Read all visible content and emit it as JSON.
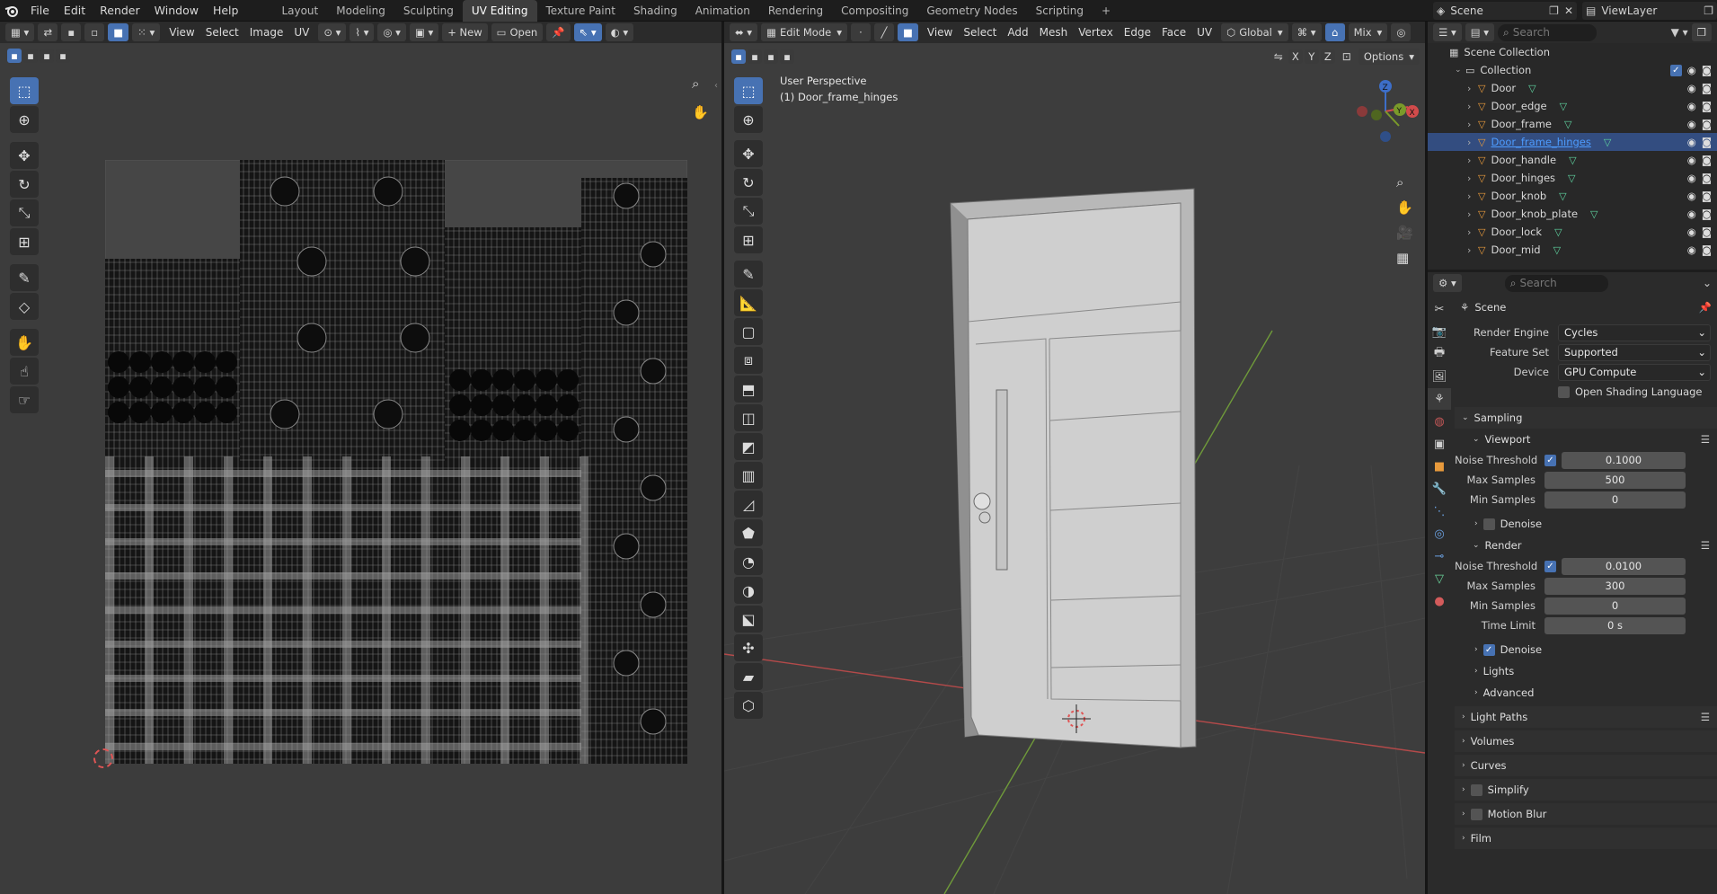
{
  "app": {
    "menu": [
      "File",
      "Edit",
      "Render",
      "Window",
      "Help"
    ]
  },
  "workspaces": [
    "Layout",
    "Modeling",
    "Sculpting",
    "UV Editing",
    "Texture Paint",
    "Shading",
    "Animation",
    "Rendering",
    "Compositing",
    "Geometry Nodes",
    "Scripting"
  ],
  "workspace_add": "+",
  "active_workspace": "UV Editing",
  "topright": {
    "scene": "Scene",
    "view_layer": "ViewLayer"
  },
  "uv_editor": {
    "menu": [
      "View",
      "Select",
      "Image",
      "UV"
    ],
    "new_label": "+ New",
    "open_label": "Open"
  },
  "viewport": {
    "mode": "Edit Mode",
    "menu": [
      "View",
      "Select",
      "Add",
      "Mesh",
      "Vertex",
      "Edge",
      "Face",
      "UV"
    ],
    "orientation": "Global",
    "shading": "Mix",
    "axes": [
      "X",
      "Y",
      "Z"
    ],
    "options_label": "Options",
    "overlay_title": "User Perspective",
    "overlay_object": "(1) Door_frame_hinges",
    "gizmo_labels": [
      "Z",
      "Y",
      "X"
    ]
  },
  "outliner": {
    "search_placeholder": "Search",
    "scene_collection": "Scene Collection",
    "collection": "Collection",
    "objects": [
      {
        "name": "Door",
        "selected": false
      },
      {
        "name": "Door_edge",
        "selected": false
      },
      {
        "name": "Door_frame",
        "selected": false
      },
      {
        "name": "Door_frame_hinges",
        "selected": true
      },
      {
        "name": "Door_handle",
        "selected": false
      },
      {
        "name": "Door_hinges",
        "selected": false
      },
      {
        "name": "Door_knob",
        "selected": false
      },
      {
        "name": "Door_knob_plate",
        "selected": false
      },
      {
        "name": "Door_lock",
        "selected": false
      },
      {
        "name": "Door_mid",
        "selected": false
      }
    ]
  },
  "properties": {
    "search_placeholder": "Search",
    "context": "Scene",
    "render_engine_label": "Render Engine",
    "render_engine": "Cycles",
    "feature_set_label": "Feature Set",
    "feature_set": "Supported",
    "device_label": "Device",
    "device": "GPU Compute",
    "osl_label": "Open Shading Language",
    "sampling": "Sampling",
    "viewport": "Viewport",
    "noise_threshold_label": "Noise Threshold",
    "vp_noise_threshold": "0.1000",
    "max_samples_label": "Max Samples",
    "vp_max_samples": "500",
    "min_samples_label": "Min Samples",
    "vp_min_samples": "0",
    "denoise_label": "Denoise",
    "render": "Render",
    "r_noise_threshold": "0.0100",
    "r_max_samples": "300",
    "r_min_samples": "0",
    "time_limit_label": "Time Limit",
    "r_time_limit": "0 s",
    "lights": "Lights",
    "advanced": "Advanced",
    "light_paths": "Light Paths",
    "volumes": "Volumes",
    "curves": "Curves",
    "simplify": "Simplify",
    "motion_blur": "Motion Blur",
    "film": "Film"
  },
  "colors": {
    "accent": "#4772b3",
    "selection": "#334d80",
    "header": "#2b2b2b",
    "editor_bg": "#3c3c3c"
  }
}
